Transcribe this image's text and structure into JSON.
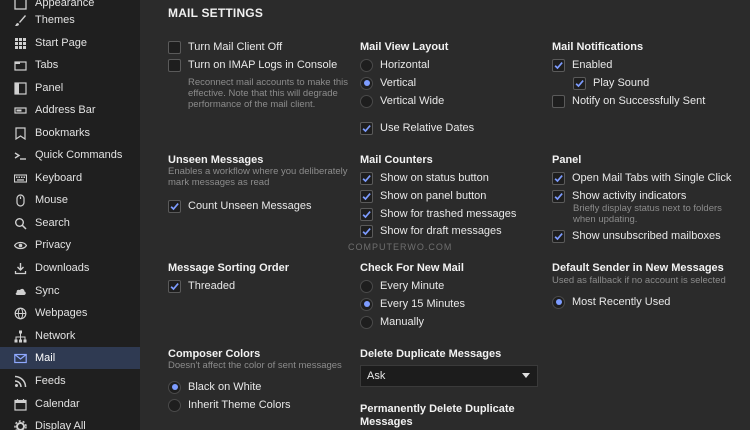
{
  "sidebar": {
    "items": [
      {
        "label": "Appearance",
        "icon": "appearance-icon"
      },
      {
        "label": "Themes",
        "icon": "brush-icon"
      },
      {
        "label": "Start Page",
        "icon": "grid-icon"
      },
      {
        "label": "Tabs",
        "icon": "tabs-icon"
      },
      {
        "label": "Panel",
        "icon": "panel-icon"
      },
      {
        "label": "Address Bar",
        "icon": "address-bar-icon"
      },
      {
        "label": "Bookmarks",
        "icon": "bookmark-icon"
      },
      {
        "label": "Quick Commands",
        "icon": "quick-commands-icon"
      },
      {
        "label": "Keyboard",
        "icon": "keyboard-icon"
      },
      {
        "label": "Mouse",
        "icon": "mouse-icon"
      },
      {
        "label": "Search",
        "icon": "search-icon"
      },
      {
        "label": "Privacy",
        "icon": "eye-icon"
      },
      {
        "label": "Downloads",
        "icon": "download-icon"
      },
      {
        "label": "Sync",
        "icon": "cloud-icon"
      },
      {
        "label": "Webpages",
        "icon": "globe-icon"
      },
      {
        "label": "Network",
        "icon": "network-icon"
      },
      {
        "label": "Mail",
        "icon": "mail-icon"
      },
      {
        "label": "Feeds",
        "icon": "rss-icon"
      },
      {
        "label": "Calendar",
        "icon": "calendar-icon"
      },
      {
        "label": "Display All",
        "icon": "gear-icon"
      }
    ],
    "active": "Mail"
  },
  "main": {
    "title": "MAIL SETTINGS",
    "mail_client": {
      "turn_off": "Turn Mail Client Off",
      "imap_logs": "Turn on IMAP Logs in Console",
      "imap_desc": "Reconnect mail accounts to make this effective. Note that this will degrade performance of the mail client."
    },
    "view_layout": {
      "heading": "Mail View Layout",
      "horizontal": "Horizontal",
      "vertical": "Vertical",
      "vertical_wide": "Vertical Wide",
      "relative_dates": "Use Relative Dates"
    },
    "notifications": {
      "heading": "Mail Notifications",
      "enabled": "Enabled",
      "play_sound": "Play Sound",
      "notify_sent": "Notify on Successfully Sent"
    },
    "unseen": {
      "heading": "Unseen Messages",
      "desc": "Enables a workflow where you deliberately mark messages as read",
      "count": "Count Unseen Messages"
    },
    "counters": {
      "heading": "Mail Counters",
      "status": "Show on status button",
      "panel": "Show on panel button",
      "trashed": "Show for trashed messages",
      "draft": "Show for draft messages"
    },
    "panel": {
      "heading": "Panel",
      "single_click": "Open Mail Tabs with Single Click",
      "activity": "Show activity indicators",
      "activity_desc": "Briefly display status next to folders when updating.",
      "unsubscribed": "Show unsubscribed mailboxes"
    },
    "sorting": {
      "heading": "Message Sorting Order",
      "threaded": "Threaded"
    },
    "check_new": {
      "heading": "Check For New Mail",
      "every_minute": "Every Minute",
      "every_15": "Every 15 Minutes",
      "manually": "Manually"
    },
    "default_sender": {
      "heading": "Default Sender in New Messages",
      "desc": "Used as fallback if no account is selected",
      "most_recent": "Most Recently Used"
    },
    "composer": {
      "heading": "Composer Colors",
      "desc": "Doesn't affect the color of sent messages",
      "black_on_white": "Black on White",
      "inherit": "Inherit Theme Colors"
    },
    "duplicates": {
      "heading": "Delete Duplicate Messages",
      "value": "Ask"
    },
    "perm_delete": {
      "heading_line1": "Permanently Delete Duplicate",
      "heading_line2": "Messages"
    },
    "watermark": "COMPUTERWO.COM"
  },
  "colors": {
    "accent": "#7d9cff",
    "sidebar_bg": "#1f1f1f",
    "main_bg": "#2b2b2b"
  }
}
